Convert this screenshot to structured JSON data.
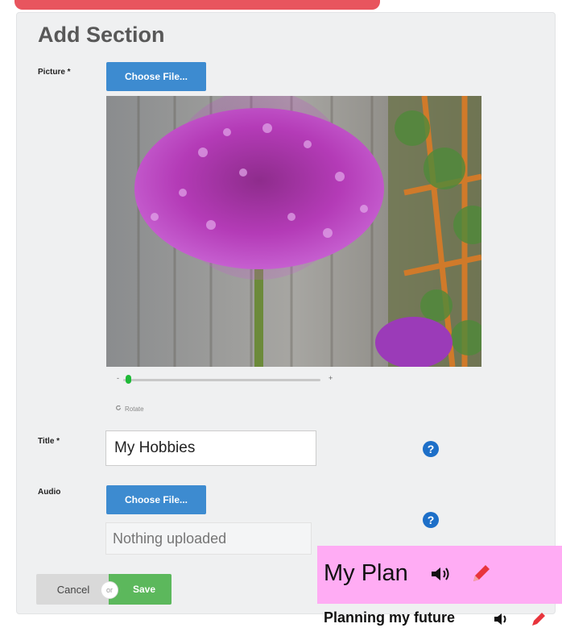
{
  "form": {
    "heading": "Add Section",
    "picture_label": "Picture *",
    "choose_file_label": "Choose File...",
    "rotate_label": "Rotate",
    "slider": {
      "minus": "-",
      "plus": "+",
      "zoom_fraction": 0.03
    },
    "title_label": "Title *",
    "title_value": "My Hobbies",
    "audio_label": "Audio",
    "audio_choose_file_label": "Choose File...",
    "audio_placeholder": "Nothing uploaded",
    "help_glyph": "?",
    "cancel_label": "Cancel",
    "or_label": "or",
    "save_label": "Save"
  },
  "plan": {
    "title": "My Plan",
    "subtitle": "Planning my future"
  },
  "icons": [
    "help-icon",
    "rotate-icon",
    "speaker-icon",
    "pencil-icon"
  ],
  "colors": {
    "banner": "#e8555e",
    "primary_button": "#3d8bd0",
    "save_button": "#5cb85c",
    "help_icon": "#1d6fc8",
    "slider_thumb": "#1fba38",
    "plan_highlight": "#ffacf4",
    "pencil": "#e8343c"
  }
}
